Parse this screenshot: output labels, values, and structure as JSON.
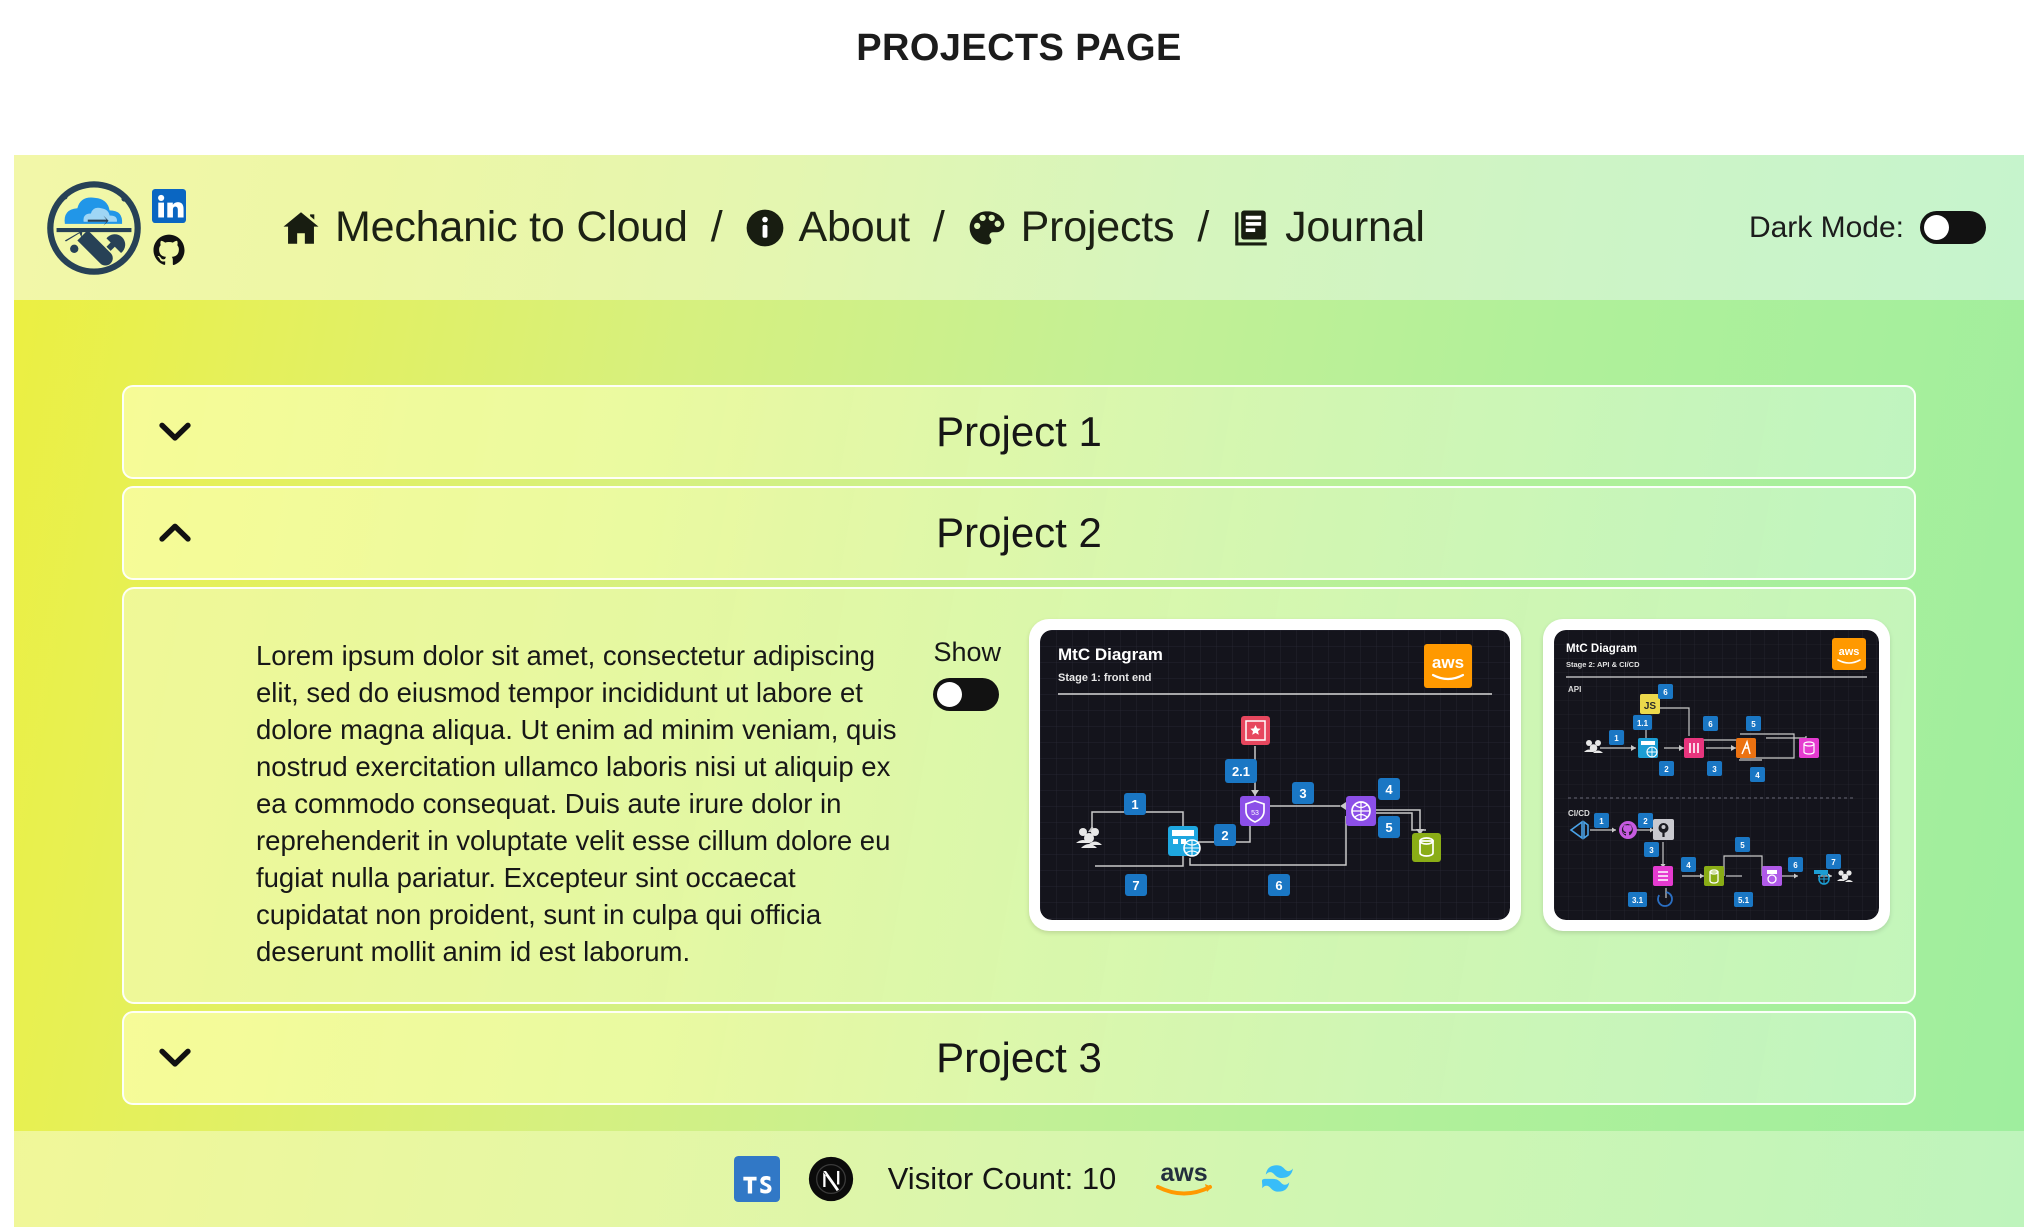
{
  "page": {
    "title": "PROJECTS PAGE"
  },
  "header": {
    "logo_alt": "mechanic-to-cloud-logo",
    "socials": [
      {
        "name": "linkedin-icon"
      },
      {
        "name": "github-icon"
      }
    ],
    "nav": [
      {
        "icon": "home-icon",
        "label": "Mechanic to Cloud",
        "sep": "/"
      },
      {
        "icon": "info-icon",
        "label": "About",
        "sep": "/"
      },
      {
        "icon": "palette-icon",
        "label": "Projects",
        "sep": "/"
      },
      {
        "icon": "journal-icon",
        "label": "Journal",
        "sep": ""
      }
    ],
    "dark_mode": {
      "label": "Dark Mode:",
      "state": "off"
    }
  },
  "main": {
    "accordion": [
      {
        "id": "project-1",
        "title": "Project 1",
        "expanded": false,
        "chevron": "chevron-down-icon"
      },
      {
        "id": "project-2",
        "title": "Project 2",
        "expanded": true,
        "chevron": "chevron-up-icon"
      },
      {
        "id": "project-3",
        "title": "Project 3",
        "expanded": false,
        "chevron": "chevron-down-icon"
      }
    ],
    "panel": {
      "body": "Lorem ipsum dolor sit amet, consectetur adipiscing elit, sed do eiusmod tempor incididunt ut labore et dolore magna aliqua. Ut enim ad minim veniam, quis nostrud exercitation ullamco laboris nisi ut aliquip ex ea commodo consequat. Duis aute irure dolor in reprehenderit in voluptate velit esse cillum dolore eu fugiat nulla pariatur. Excepteur sint occaecat cupidatat non proident, sunt in culpa qui officia deserunt mollit anim id est laborum.",
      "show_label": "Show",
      "show_state": "off",
      "diagrams": [
        {
          "id": "diagram-stage-1",
          "title": "MtC Diagram",
          "subtitle": "Stage 1: front end",
          "brand": "aws",
          "sections": [],
          "step_labels": [
            "1",
            "2",
            "2.1",
            "3",
            "4",
            "5",
            "6",
            "7"
          ]
        },
        {
          "id": "diagram-stage-2",
          "title": "MtC Diagram",
          "subtitle": "Stage 2: API & CI/CD",
          "brand": "aws",
          "sections": [
            "API",
            "CI/CD"
          ],
          "step_labels": [
            "1",
            "1.1",
            "2",
            "3",
            "4",
            "5",
            "6",
            "1",
            "2",
            "3",
            "3.1",
            "4",
            "5",
            "5.1",
            "6",
            "7"
          ]
        }
      ]
    }
  },
  "footer": {
    "icons_left": [
      {
        "name": "typescript-icon"
      },
      {
        "name": "nextjs-icon"
      }
    ],
    "visitor_text": "Visitor Count: 10",
    "icons_right": [
      {
        "name": "aws-icon"
      },
      {
        "name": "tailwind-icon"
      }
    ]
  },
  "colors": {
    "bg_start": "#ecef3f",
    "bg_end": "#9eee9e",
    "nav_start": "#f2f7a8",
    "nav_end": "#c6f4cd",
    "text": "#161616",
    "aws_orange": "#ff9900",
    "diagram_bg": "#14141c",
    "step_blue": "#1a77c4"
  }
}
